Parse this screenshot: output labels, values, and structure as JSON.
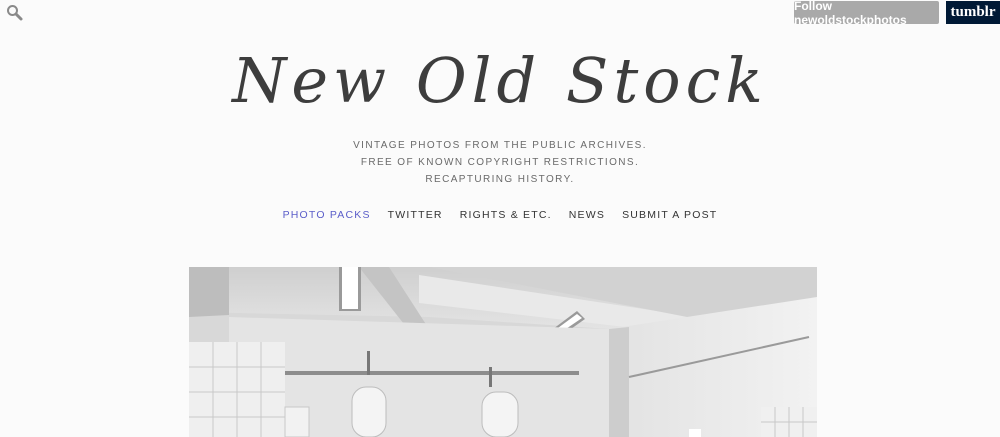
{
  "header": {
    "search_icon": "search-icon",
    "follow_label": "Follow newoldstockphotos",
    "tumblr_label": "tumblr"
  },
  "site": {
    "title": "New Old Stock",
    "tagline": [
      "VINTAGE PHOTOS FROM THE PUBLIC ARCHIVES.",
      "FREE OF KNOWN COPYRIGHT RESTRICTIONS.",
      "RECAPTURING HISTORY."
    ]
  },
  "nav": {
    "items": [
      {
        "label": "PHOTO PACKS",
        "active": true
      },
      {
        "label": "TWITTER",
        "active": false
      },
      {
        "label": "RIGHTS & ETC.",
        "active": false
      },
      {
        "label": "NEWS",
        "active": false
      },
      {
        "label": "SUBMIT A POST",
        "active": false
      }
    ]
  },
  "colors": {
    "background": "#fbfbfb",
    "title": "#3d3d3d",
    "nav_active": "#5b5ec9",
    "follow_button": "#a9a9a9",
    "tumblr_brand": "#001935"
  }
}
